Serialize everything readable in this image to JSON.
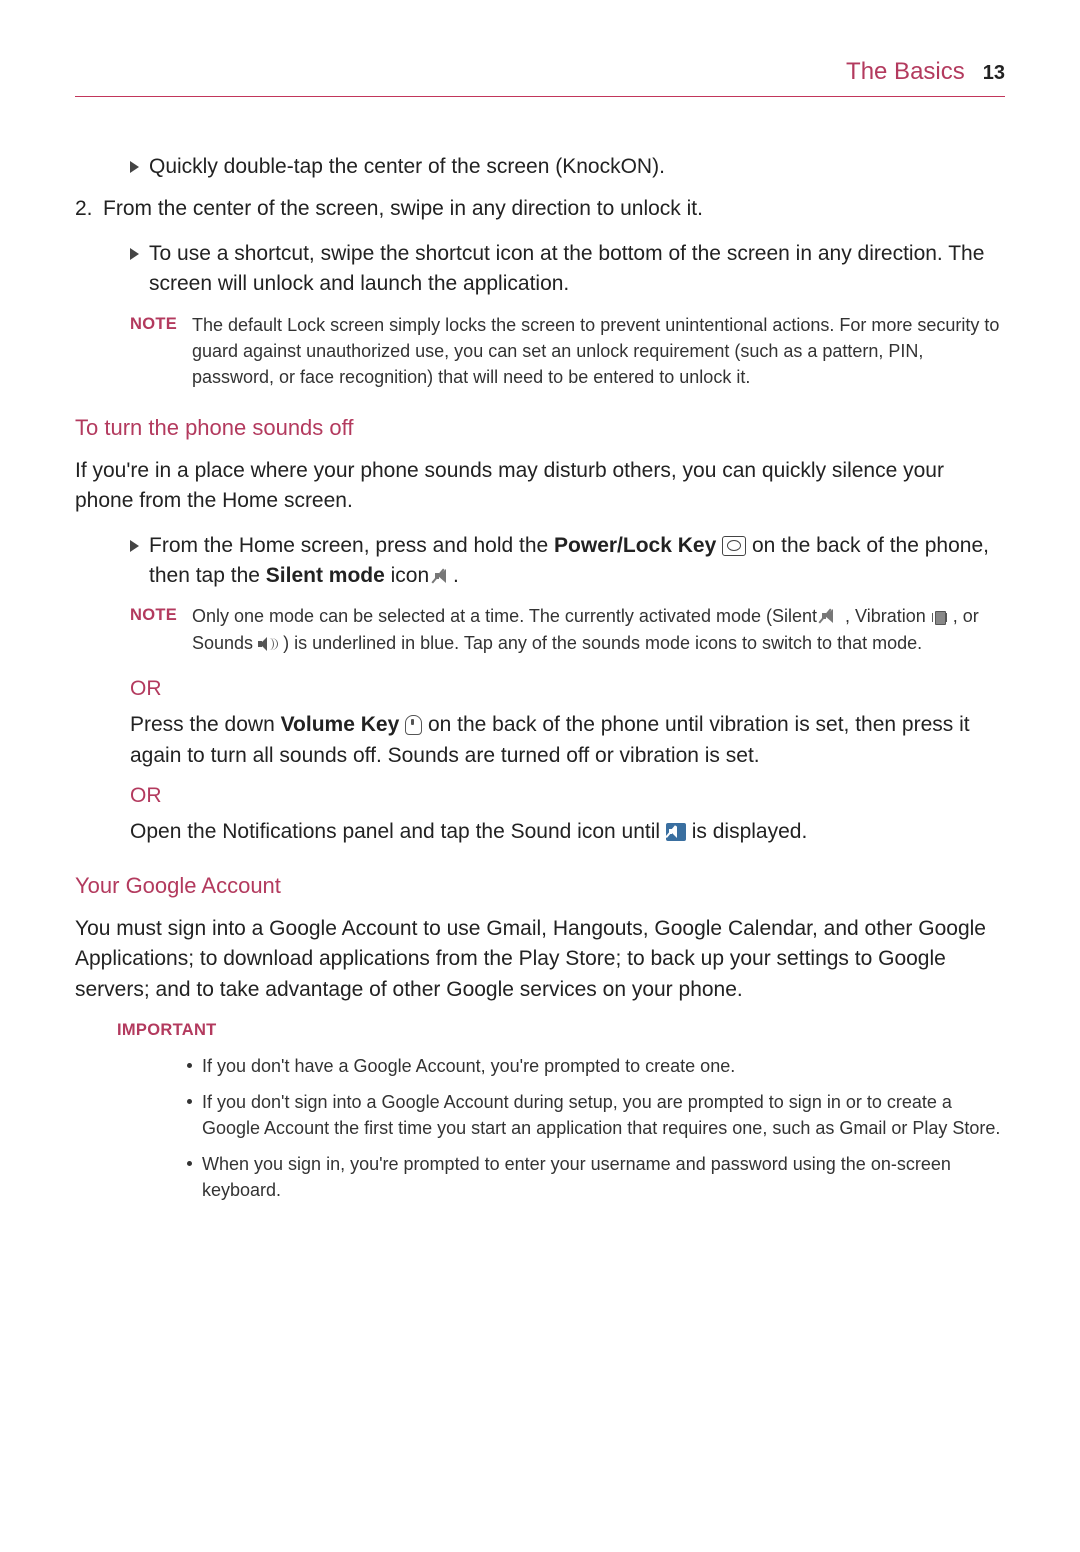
{
  "header": {
    "title": "The Basics",
    "page": "13"
  },
  "bullets": {
    "knockon": "Quickly double-tap the center of the screen (KnockON).",
    "step2_num": "2.",
    "step2_text": "From the center of the screen, swipe in any direction to unlock it.",
    "shortcut": "To use a shortcut, swipe the shortcut icon at the bottom of the screen in any direction. The screen will unlock and launch the application."
  },
  "note1": {
    "label": "NOTE",
    "text": "The default Lock screen simply locks the screen to prevent unintentional actions. For more security to guard against unauthorized use, you can set an unlock requirement (such as a pattern, PIN, password, or face recognition) that will need to be entered to unlock it."
  },
  "sounds": {
    "heading": "To turn the phone sounds off",
    "intro": "If you're in a place where your phone sounds may disturb others, you can quickly silence your phone from the Home screen.",
    "bullet_a": "From the Home screen, press and hold the ",
    "bullet_b": "Power/Lock Key",
    "bullet_c": " on the back of the phone, then tap the ",
    "bullet_d": "Silent mode",
    "bullet_e": " icon ",
    "note_label": "NOTE",
    "note_a": "Only one mode can be selected at a time. The currently activated mode (Silent ",
    "note_b": ", Vibration ",
    "note_c": ", or Sounds ",
    "note_d": ") is underlined in blue. Tap any of the sounds mode icons to switch to that mode.",
    "or": "OR",
    "vol_a": "Press the down ",
    "vol_b": "Volume Key",
    "vol_c": " on the back of the phone until vibration is set, then press it again to turn all sounds off. Sounds are turned off or vibration is set.",
    "notif_a": "Open the Notifications panel and tap the Sound icon until ",
    "notif_b": " is displayed."
  },
  "google": {
    "heading": "Your Google Account",
    "intro": "You must sign into a Google Account to use Gmail, Hangouts, Google Calendar, and other Google Applications; to download applications from the Play Store; to back up your settings to Google servers; and to take advantage of other Google services on your phone.",
    "important_label": "IMPORTANT",
    "items": [
      "If you don't have a Google Account, you're prompted to create one.",
      "If you don't sign into a Google Account during setup, you are prompted to sign in or to create a Google Account the first time you start an application that requires one, such as Gmail or Play Store.",
      "When you sign in, you're prompted to enter your username and password using the on-screen keyboard."
    ]
  }
}
